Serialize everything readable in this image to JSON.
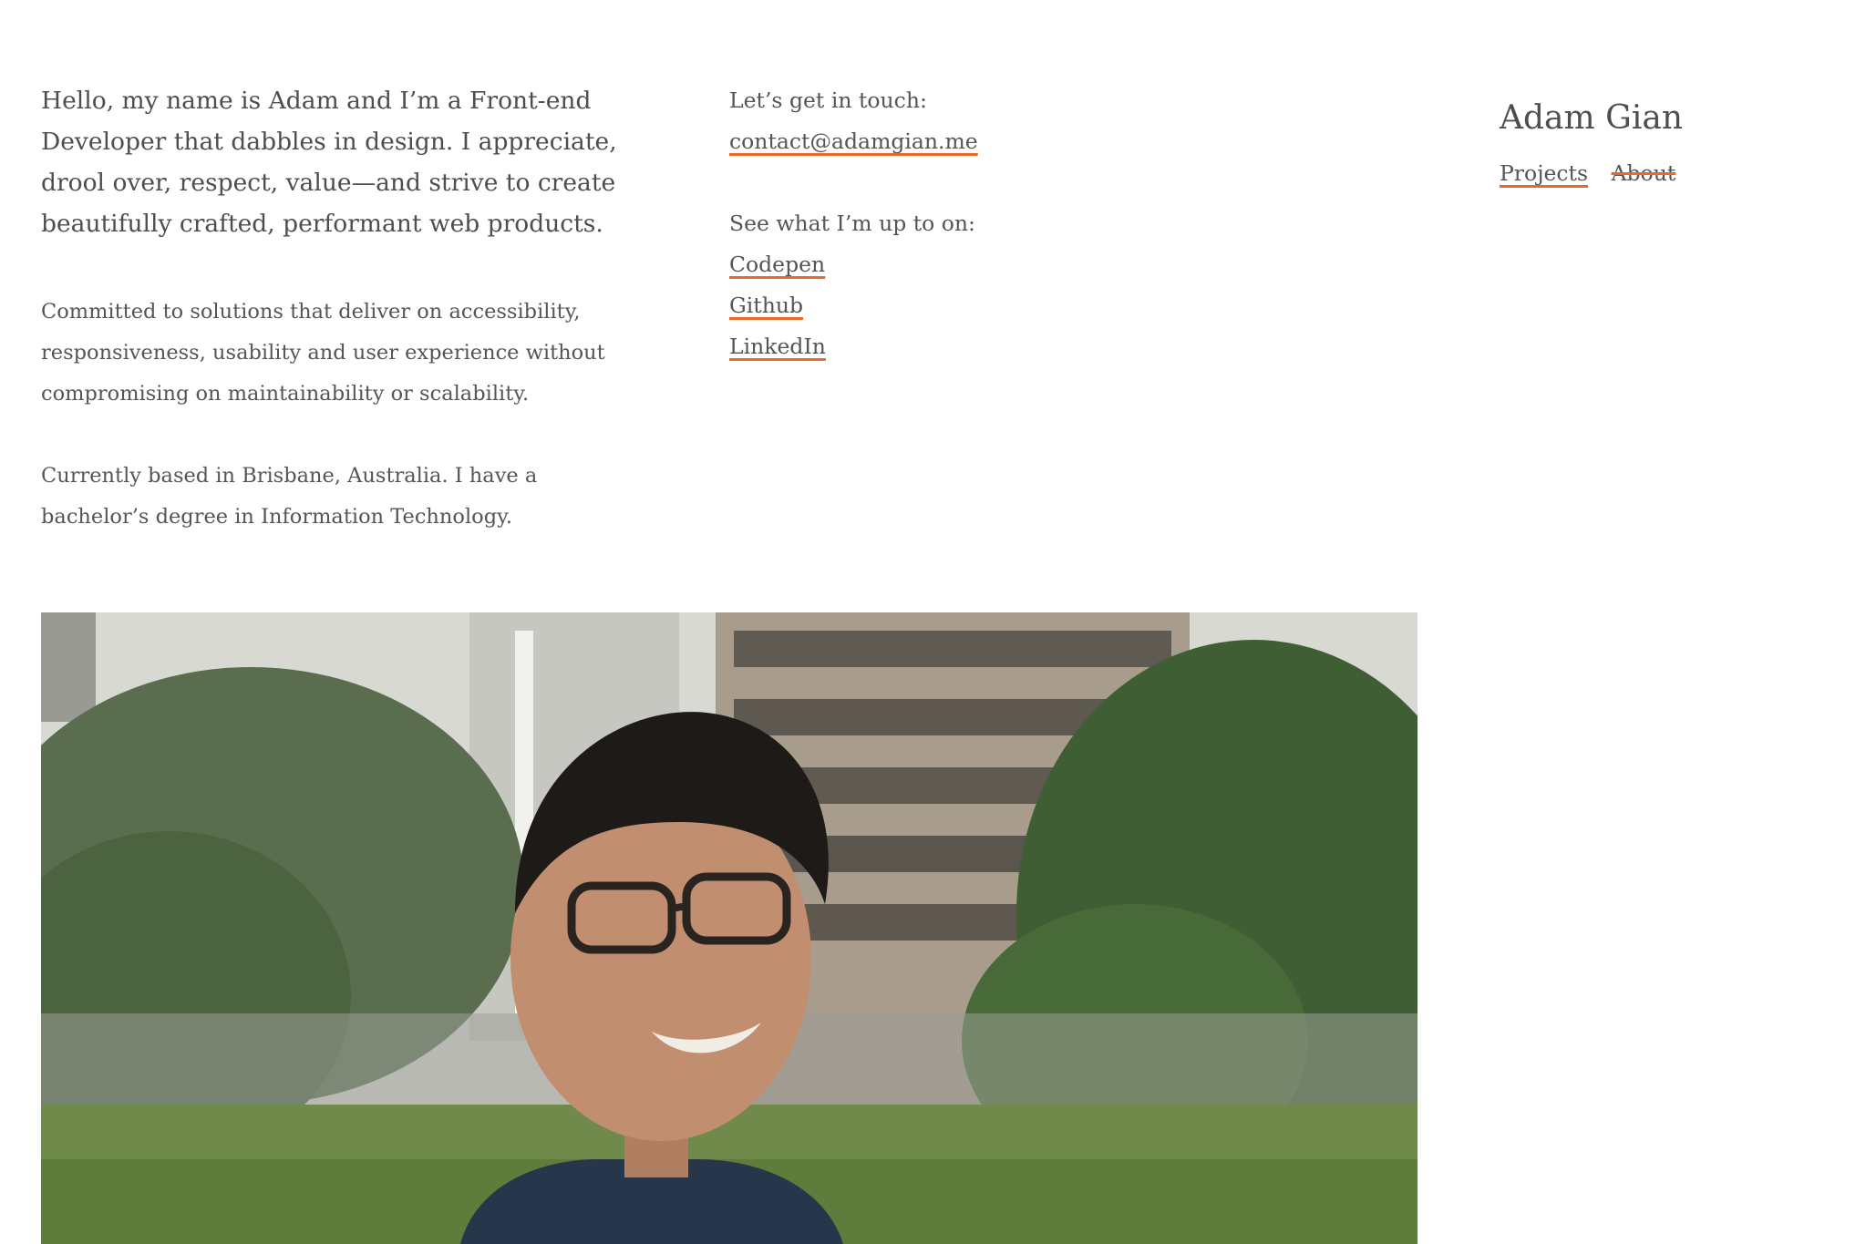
{
  "intro": {
    "lead": "Hello, my name is Adam and I’m a Front-end Developer that dabbles in design. I appreciate, drool over, respect, value—and strive to create beautifully crafted, performant web products.",
    "commitment": "Committed to solutions that deliver on accessibility, responsiveness, usability and user experience without compromising on maintainability or scalability.",
    "location": "Currently based in Brisbane, Australia. I have a bachelor’s degree in Information Technology."
  },
  "contact": {
    "heading": "Let’s get in touch:",
    "email": "contact@adamgian.me",
    "social_heading": "See what I’m up to on:",
    "links": [
      "Codepen",
      "Github",
      "LinkedIn"
    ]
  },
  "site": {
    "title": "Adam Gian",
    "nav": [
      {
        "label": "Projects",
        "current": false
      },
      {
        "label": "About",
        "current": true
      }
    ]
  },
  "photo": {
    "icon": "portrait-photo"
  },
  "colors": {
    "accent": "#e8692b",
    "text": "#555555",
    "background": "#ffffff"
  }
}
